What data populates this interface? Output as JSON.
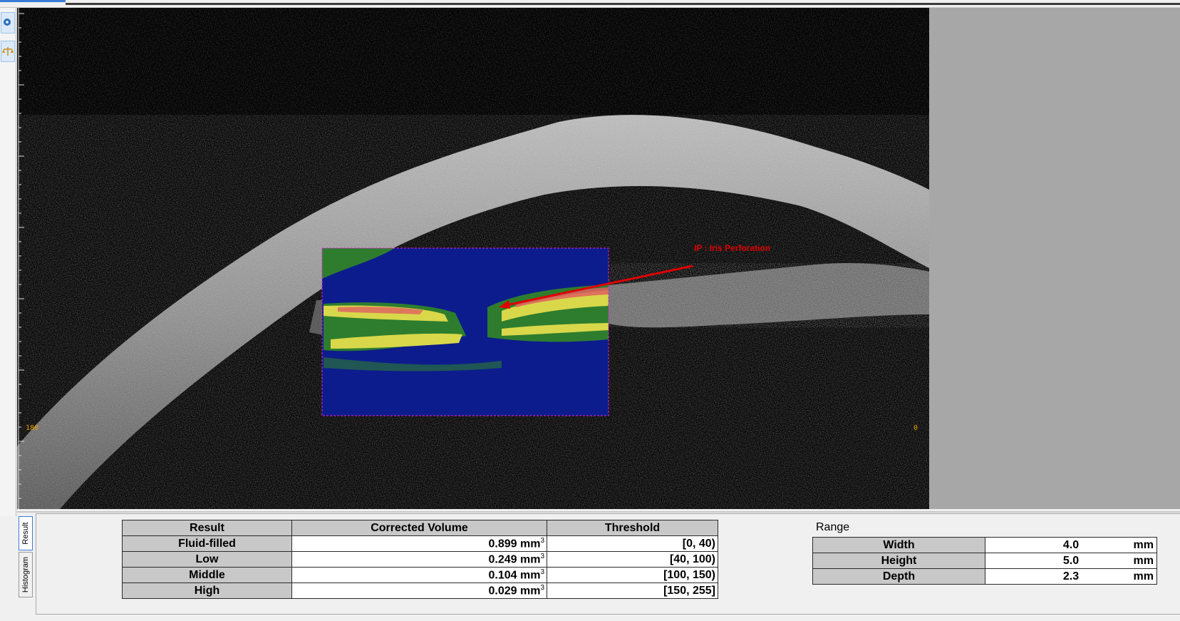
{
  "viewer": {
    "left_degree_label": "180",
    "right_degree_label": "0",
    "annotation": {
      "text": "IP : Iris Perforation",
      "color": "#e00000"
    },
    "overlay_colors": [
      "#0c1c8c",
      "#2e7d2e",
      "#d8d84a",
      "#e06060"
    ]
  },
  "tabs": {
    "result": "Result",
    "histogram": "Histogram"
  },
  "result_table": {
    "headers": [
      "Result",
      "Corrected Volume",
      "Threshold"
    ],
    "unit": "mm",
    "unit_exponent": "3",
    "rows": [
      {
        "name": "Fluid-filled",
        "volume": "0.899",
        "threshold": "[0, 40)"
      },
      {
        "name": "Low",
        "volume": "0.249",
        "threshold": "[40, 100)"
      },
      {
        "name": "Middle",
        "volume": "0.104",
        "threshold": "[100, 150)"
      },
      {
        "name": "High",
        "volume": "0.029",
        "threshold": "[150, 255]"
      }
    ]
  },
  "range": {
    "title": "Range",
    "unit": "mm",
    "rows": [
      {
        "name": "Width",
        "value": "4.0"
      },
      {
        "name": "Height",
        "value": "5.0"
      },
      {
        "name": "Depth",
        "value": "2.3"
      }
    ]
  }
}
